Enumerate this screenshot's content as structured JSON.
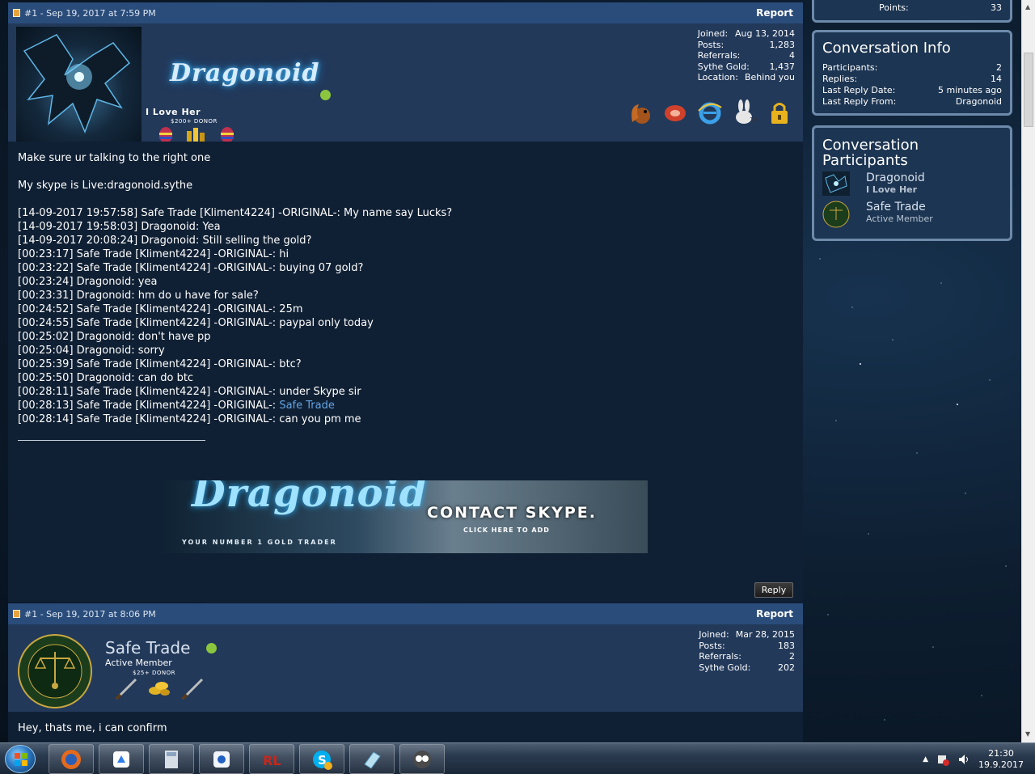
{
  "posts": [
    {
      "header": {
        "label": "#1 - Sep 19, 2017 at 7:59 PM",
        "report": "Report"
      },
      "user": {
        "name": "Dragonoid",
        "title": "I Love Her",
        "donor": "$200+ DONOR",
        "stats": [
          {
            "label": "Joined:",
            "value": "Aug 13, 2014"
          },
          {
            "label": "Posts:",
            "value": "1,283"
          },
          {
            "label": "Referrals:",
            "value": "4"
          },
          {
            "label": "Sythe Gold:",
            "value": "1,437"
          },
          {
            "label": "Location:",
            "value": "Behind you"
          }
        ]
      },
      "body": {
        "intro": "Make sure ur talking to the right one",
        "skype": "My skype is Live:dragonoid.sythe",
        "chat": [
          "[14-09-2017 19:57:58] Safe Trade [Kliment4224] -ORIGINAL-: My name say Lucks?",
          "[14-09-2017 19:58:03] Dragonoid: Yea",
          "[14-09-2017 20:08:24] Dragonoid: Still selling the gold?",
          "[00:23:17] Safe Trade [Kliment4224] -ORIGINAL-: hi",
          "[00:23:22] Safe Trade [Kliment4224] -ORIGINAL-: buying 07 gold?",
          "[00:23:24] Dragonoid: yea",
          "[00:23:31] Dragonoid: hm do u have for sale?",
          "[00:24:52] Safe Trade [Kliment4224] -ORIGINAL-: 25m",
          "[00:24:55] Safe Trade [Kliment4224] -ORIGINAL-: paypal only today",
          "[00:25:02] Dragonoid: don't have pp",
          "[00:25:04] Dragonoid: sorry",
          "[00:25:39] Safe Trade [Kliment4224] -ORIGINAL-: btc?",
          "[00:25:50] Dragonoid: can do btc",
          "[00:28:11] Safe Trade [Kliment4224] -ORIGINAL-: under Skype sir"
        ],
        "chat_link_prefix": "[00:28:13] Safe Trade [Kliment4224] -ORIGINAL-: ",
        "chat_link_text": "Safe Trade",
        "chat_last": "[00:28:14] Safe Trade [Kliment4224] -ORIGINAL-: can you pm me",
        "banner": {
          "brand": "Dragonoid",
          "tagline": "YOUR NUMBER 1 GOLD TRADER",
          "contact": "CONTACT SKYPE.",
          "click": "CLICK HERE TO ADD"
        },
        "reply": "Reply"
      }
    },
    {
      "header": {
        "label": "#1 - Sep 19, 2017 at 8:06 PM",
        "report": "Report"
      },
      "user": {
        "name": "Safe Trade",
        "title": "Active Member",
        "donor": "$25+ DONOR",
        "stats": [
          {
            "label": "Joined:",
            "value": "Mar 28, 2015"
          },
          {
            "label": "Posts:",
            "value": "183"
          },
          {
            "label": "Referrals:",
            "value": "2"
          },
          {
            "label": "Sythe Gold:",
            "value": "202"
          }
        ]
      },
      "body": {
        "intro": "Hey, thats me, i can confirm"
      }
    }
  ],
  "sidebar": {
    "points": {
      "label": "Points:",
      "value": "33"
    },
    "conversation_info": {
      "title": "Conversation Info",
      "rows": [
        {
          "label": "Participants:",
          "value": "2"
        },
        {
          "label": "Replies:",
          "value": "14"
        },
        {
          "label": "Last Reply Date:",
          "value": "5 minutes ago"
        },
        {
          "label": "Last Reply From:",
          "value": "Dragonoid"
        }
      ]
    },
    "participants": {
      "title_line1": "Conversation",
      "title_line2": "Participants",
      "list": [
        {
          "name": "Dragonoid",
          "title": "I Love Her"
        },
        {
          "name": "Safe Trade",
          "title": "Active Member"
        }
      ]
    }
  },
  "taskbar": {
    "clock_time": "21:30",
    "clock_date": "19.9.2017",
    "apps": [
      "firefox",
      "google-drive",
      "calculator",
      "app-blue",
      "runelite",
      "skype",
      "notes",
      "owl-app"
    ]
  },
  "colors": {
    "header_bar": "#2a4c7a",
    "user_panel": "#22395a",
    "post_body": "#102034",
    "online": "#8cc63f",
    "link": "#63a4e4"
  }
}
